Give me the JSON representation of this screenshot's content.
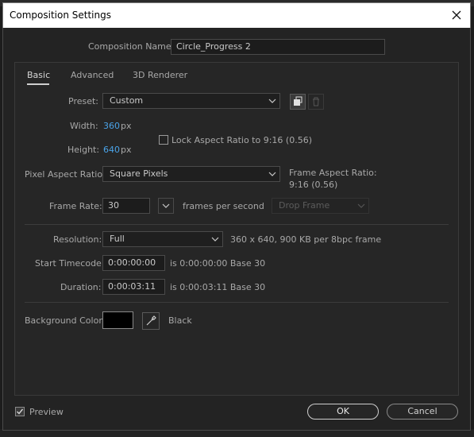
{
  "window": {
    "title": "Composition Settings"
  },
  "comp_name": {
    "label": "Composition Name:",
    "value": "Circle_Progress 2"
  },
  "tabs": [
    {
      "label": "Basic"
    },
    {
      "label": "Advanced"
    },
    {
      "label": "3D Renderer"
    }
  ],
  "preset": {
    "label": "Preset:",
    "value": "Custom"
  },
  "width": {
    "label": "Width:",
    "value": "360",
    "unit": "px"
  },
  "height": {
    "label": "Height:",
    "value": "640",
    "unit": "px"
  },
  "lock_aspect": {
    "label": "Lock Aspect Ratio to 9:16 (0.56)",
    "checked": false
  },
  "pixel_aspect": {
    "label": "Pixel Aspect Ratio:",
    "value": "Square Pixels"
  },
  "frame_aspect": {
    "label": "Frame Aspect Ratio:",
    "value": "9:16 (0.56)"
  },
  "frame_rate": {
    "label": "Frame Rate:",
    "value": "30",
    "unit": "frames per second",
    "drop_frame": "Drop Frame"
  },
  "resolution": {
    "label": "Resolution:",
    "value": "Full",
    "info": "360 x 640, 900 KB per 8bpc frame"
  },
  "start_timecode": {
    "label": "Start Timecode:",
    "value": "0:00:00:00",
    "info": "is 0:00:00:00  Base 30"
  },
  "duration": {
    "label": "Duration:",
    "value": "0:00:03:11",
    "info": "is 0:00:03:11  Base 30"
  },
  "background": {
    "label": "Background Color:",
    "color": "#000000",
    "name": "Black"
  },
  "footer": {
    "preview_label": "Preview",
    "preview_checked": true,
    "ok_label": "OK",
    "cancel_label": "Cancel"
  }
}
